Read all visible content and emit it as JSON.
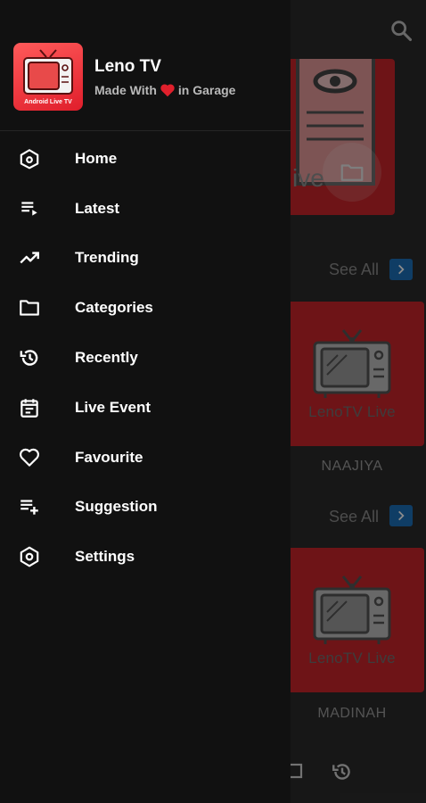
{
  "app": {
    "name": "Leno TV",
    "tagline_before": "Made With",
    "tagline_after": "in Garage",
    "logo_caption": "Android Live TV"
  },
  "menu": {
    "items": [
      {
        "label": "Home",
        "icon": "home-icon"
      },
      {
        "label": "Latest",
        "icon": "playlist-icon"
      },
      {
        "label": "Trending",
        "icon": "trending-icon"
      },
      {
        "label": "Categories",
        "icon": "folder-icon"
      },
      {
        "label": "Recently",
        "icon": "history-icon"
      },
      {
        "label": "Live Event",
        "icon": "event-icon"
      },
      {
        "label": "Favourite",
        "icon": "heart-icon"
      },
      {
        "label": "Suggestion",
        "icon": "playlist-add-icon"
      },
      {
        "label": "Settings",
        "icon": "settings-icon"
      }
    ]
  },
  "background": {
    "top_card_text": "ive",
    "see_all_label": "See All",
    "cards": [
      {
        "caption": "LenoTV Live",
        "title": "NAAJIYA"
      },
      {
        "caption": "LenoTV Live",
        "title": "MADINAH"
      }
    ]
  },
  "colors": {
    "drawer_bg": "#111111",
    "card_red": "#c8262a",
    "accent_blue": "#1d6fb8",
    "heart": "#e0202c"
  }
}
